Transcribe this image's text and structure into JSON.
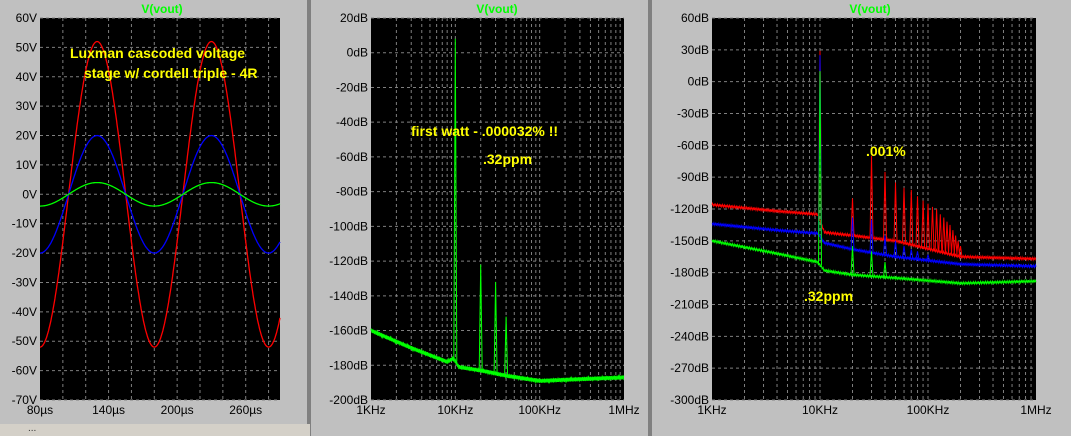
{
  "chart_data": [
    {
      "type": "line",
      "title": "V(vout)",
      "x_ticks": [
        "80µs",
        "140µs",
        "200µs",
        "260µs"
      ],
      "y_ticks": [
        "60V",
        "50V",
        "40V",
        "30V",
        "20V",
        "10V",
        "0V",
        "-10V",
        "-20V",
        "-30V",
        "-40V",
        "-50V",
        "-60V",
        "-70V"
      ],
      "xlim": [
        80,
        290
      ],
      "ylim": [
        -70,
        60
      ],
      "annotations": [
        "Luxman cascoded voltage",
        "stage w/ cordell triple - 4R"
      ],
      "series": [
        {
          "color": "#ff0000",
          "amplitude": 52,
          "period_us": 100,
          "peak_us": 130
        },
        {
          "color": "#0000ff",
          "amplitude": 20,
          "period_us": 100,
          "peak_us": 130
        },
        {
          "color": "#00ff00",
          "amplitude": 4,
          "period_us": 100,
          "peak_us": 130
        }
      ]
    },
    {
      "type": "line",
      "title": "V(vout)",
      "x_scale": "log",
      "x_ticks": [
        "1KHz",
        "10KHz",
        "100KHz",
        "1MHz"
      ],
      "y_ticks": [
        "20dB",
        "0dB",
        "-20dB",
        "-40dB",
        "-60dB",
        "-80dB",
        "-100dB",
        "-120dB",
        "-140dB",
        "-160dB",
        "-180dB",
        "-200dB"
      ],
      "xlim_hz": [
        1000,
        1000000
      ],
      "ylim": [
        -200,
        20
      ],
      "annotations": [
        "first watt - .000032% !!",
        ".32ppm"
      ],
      "series": [
        {
          "color": "#00ff00",
          "noise_floor": [
            [
              1000,
              -160
            ],
            [
              3000,
              -170
            ],
            [
              8000,
              -178
            ],
            [
              9500,
              -176
            ],
            [
              11000,
              -181
            ],
            [
              20000,
              -183
            ],
            [
              40000,
              -186
            ],
            [
              100000,
              -189
            ],
            [
              300000,
              -188
            ],
            [
              1000000,
              -187
            ]
          ],
          "peaks": [
            [
              10000,
              8
            ],
            [
              20000,
              -122
            ],
            [
              30000,
              -132
            ],
            [
              40000,
              -152
            ]
          ]
        }
      ]
    },
    {
      "type": "line",
      "title": "V(vout)",
      "x_scale": "log",
      "x_ticks": [
        "1KHz",
        "10KHz",
        "100KHz",
        "1MHz"
      ],
      "y_ticks": [
        "60dB",
        "30dB",
        "0dB",
        "-30dB",
        "-60dB",
        "-90dB",
        "-120dB",
        "-150dB",
        "-180dB",
        "-210dB",
        "-240dB",
        "-270dB",
        "-300dB"
      ],
      "xlim_hz": [
        1000,
        1000000
      ],
      "ylim": [
        -300,
        60
      ],
      "annotations": [
        ".001%",
        ".32ppm"
      ],
      "series": [
        {
          "color": "#ff0000",
          "noise_floor": [
            [
              1000,
              -116
            ],
            [
              4000,
              -122
            ],
            [
              9500,
              -125
            ],
            [
              11000,
              -142
            ],
            [
              20000,
              -145
            ],
            [
              50000,
              -150
            ],
            [
              200000,
              -165
            ],
            [
              1000000,
              -167
            ]
          ],
          "peaks": [
            [
              10000,
              29
            ],
            [
              20000,
              -110
            ],
            [
              30000,
              -70
            ],
            [
              40000,
              -85
            ],
            [
              50000,
              -95
            ],
            [
              60000,
              -100
            ],
            [
              70000,
              -102
            ],
            [
              80000,
              -108
            ],
            [
              90000,
              -112
            ],
            [
              100000,
              -115
            ],
            [
              110000,
              -118
            ],
            [
              120000,
              -120
            ],
            [
              130000,
              -125
            ],
            [
              140000,
              -128
            ],
            [
              150000,
              -132
            ],
            [
              160000,
              -135
            ],
            [
              170000,
              -140
            ],
            [
              180000,
              -145
            ],
            [
              190000,
              -150
            ],
            [
              200000,
              -155
            ]
          ]
        },
        {
          "color": "#0000ff",
          "noise_floor": [
            [
              1000,
              -134
            ],
            [
              4000,
              -140
            ],
            [
              9500,
              -143
            ],
            [
              11000,
              -152
            ],
            [
              20000,
              -158
            ],
            [
              50000,
              -165
            ],
            [
              200000,
              -172
            ],
            [
              1000000,
              -174
            ]
          ],
          "peaks": [
            [
              10000,
              25
            ],
            [
              20000,
              -128
            ],
            [
              30000,
              -130
            ],
            [
              40000,
              -145
            ],
            [
              50000,
              -150
            ],
            [
              60000,
              -155
            ],
            [
              70000,
              -158
            ],
            [
              80000,
              -160
            ],
            [
              100000,
              -163
            ]
          ]
        },
        {
          "color": "#00ff00",
          "noise_floor": [
            [
              1000,
              -150
            ],
            [
              4000,
              -162
            ],
            [
              9500,
              -170
            ],
            [
              11000,
              -178
            ],
            [
              20000,
              -182
            ],
            [
              50000,
              -185
            ],
            [
              200000,
              -190
            ],
            [
              1000000,
              -188
            ]
          ],
          "peaks": [
            [
              10000,
              10
            ],
            [
              20000,
              -155
            ],
            [
              30000,
              -160
            ],
            [
              40000,
              -170
            ]
          ]
        }
      ]
    }
  ],
  "status": {
    "text": "..."
  }
}
